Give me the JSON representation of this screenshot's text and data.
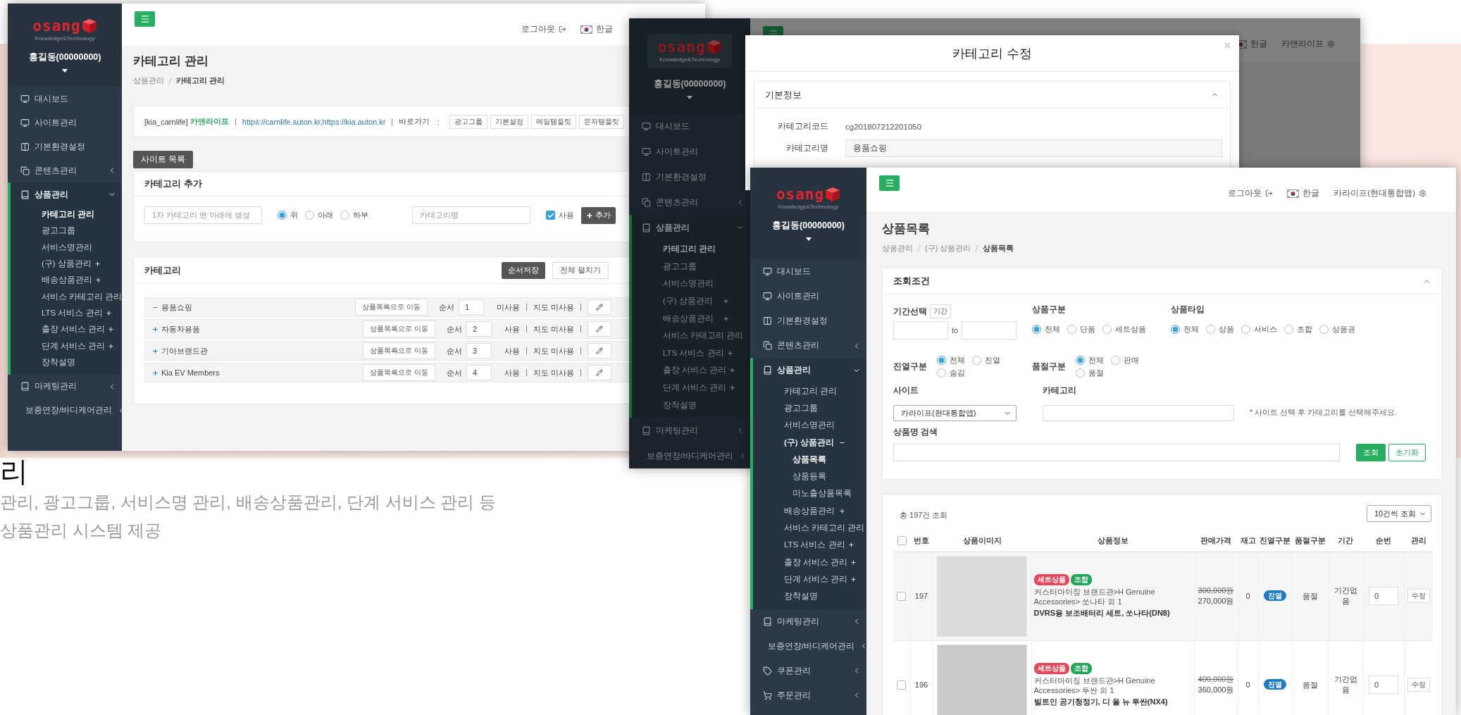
{
  "background": {
    "heading": "리",
    "description_lines": [
      "관리, 광고그룹, 서비스명 관리, 배송상품관리, 단계 서비스 관리 등",
      "상품관리 시스템 제공"
    ]
  },
  "category_window": {
    "sidebar": {
      "logo": {
        "wordmark": "osang",
        "tagline": "Knowledge&Technology"
      },
      "user": "홍길동(00000000)",
      "menu": [
        {
          "label": "대시보드",
          "kind": "monitor",
          "selected": false
        },
        {
          "label": "사이트관리",
          "kind": "monitor",
          "selected": false
        },
        {
          "label": "기본환경설정",
          "kind": "columns",
          "selected": false
        },
        {
          "label": "콘텐츠관리",
          "kind": "copy",
          "selected": false,
          "expanded": false
        },
        {
          "label": "상품관리",
          "kind": "book",
          "selected": false,
          "expanded": true,
          "children": [
            {
              "label": "카테고리 관리",
              "selected": true
            },
            {
              "label": "광고그룹",
              "selected": false
            },
            {
              "label": "서비스명관리",
              "selected": false
            },
            {
              "label": "(구) 상품관리",
              "selected": false,
              "expanded": false
            },
            {
              "label": "배송상품관리",
              "selected": false,
              "expanded": false
            },
            {
              "label": "서비스 카테고리 관리",
              "selected": false
            },
            {
              "label": "LTS 서비스 관리",
              "selected": false,
              "expanded": false
            },
            {
              "label": "출장 서비스 관리",
              "selected": false,
              "expanded": false
            },
            {
              "label": "단계 서비스 관리",
              "selected": false,
              "expanded": false
            },
            {
              "label": "장착설명",
              "selected": false
            }
          ]
        },
        {
          "label": "마케팅관리",
          "kind": "book",
          "selected": false,
          "expanded": false
        },
        {
          "label": "보증연장/바디케어관리",
          "kind": "book",
          "selected": false,
          "expanded": false
        }
      ]
    },
    "top_bar": {
      "logout": "로그아웃",
      "language": "한글"
    },
    "page_title": "카테고리 관리",
    "breadcrumb": [
      "상품관리",
      "카테고리 관리"
    ],
    "site_info": {
      "site_id": "[kia_carnlife]",
      "site_name": "카앤라이프",
      "url": "https://carnlife.auton.kr,https://kia.auton.kr",
      "shortcut_label": "바로가기",
      "shortcut_colon": ":",
      "shortcuts": [
        "광고그룹",
        "기본설정",
        "메일템플릿",
        "문자템플릿"
      ]
    },
    "site_list_button": "사이트 목록",
    "add_card": {
      "title": "카테고리 추가",
      "parent_placeholder": "1차 카테고리 맨 아래에 생성",
      "positions": [
        {
          "label": "위",
          "selected": true
        },
        {
          "label": "아래",
          "selected": false
        },
        {
          "label": "하부",
          "selected": false
        }
      ],
      "name_placeholder": "카테고리명",
      "use": {
        "label": "사용",
        "checked": true
      },
      "add_button": "추가"
    },
    "list_card": {
      "title": "카테고리",
      "save_order_button": "순서저장",
      "expand_all_button": "전체 펼치기",
      "rows": [
        {
          "name": "용품쇼핑",
          "expanded": true,
          "move_button": "상품목록으로 이동",
          "order_label": "순서",
          "order": "1",
          "status": "미사용",
          "map_status": "지도 미사용"
        },
        {
          "name": "자동차용품",
          "expanded": false,
          "move_button": "상품목록으로 이동",
          "order_label": "순서",
          "order": "2",
          "status": "사용",
          "map_status": "지도 미사용"
        },
        {
          "name": "기아브랜드관",
          "expanded": false,
          "move_button": "상품목록으로 이동",
          "order_label": "순서",
          "order": "3",
          "status": "사용",
          "map_status": "지도 미사용"
        },
        {
          "name": "Kia EV Members",
          "expanded": false,
          "move_button": "상품목록으로 이동",
          "order_label": "순서",
          "order": "4",
          "status": "사용",
          "map_status": "지도 미사용"
        }
      ]
    }
  },
  "edit_window": {
    "sidebar": {
      "logo": {
        "wordmark": "osang",
        "tagline": "Knowledge&Technology"
      },
      "user": "홍길동(00000000)",
      "menu": [
        {
          "label": "대시보드",
          "kind": "monitor",
          "selected": false
        },
        {
          "label": "사이트관리",
          "kind": "monitor",
          "selected": false
        },
        {
          "label": "기본환경설정",
          "kind": "columns",
          "selected": false
        },
        {
          "label": "콘텐츠관리",
          "kind": "copy",
          "selected": false,
          "expanded": false
        },
        {
          "label": "상품관리",
          "kind": "book",
          "selected": false,
          "expanded": true,
          "children": [
            {
              "label": "카테고리 관리",
              "selected": true
            },
            {
              "label": "광고그룹",
              "selected": false
            },
            {
              "label": "서비스명관리",
              "selected": false
            },
            {
              "label": "(구) 상품관리",
              "selected": false,
              "expanded": false
            },
            {
              "label": "배송상품관리",
              "selected": false,
              "expanded": false
            },
            {
              "label": "서비스 카테고리 관리",
              "selected": false
            },
            {
              "label": "LTS 서비스 관리",
              "selected": false,
              "expanded": false
            },
            {
              "label": "출장 서비스 관리",
              "selected": false,
              "expanded": false
            },
            {
              "label": "단계 서비스 관리",
              "selected": false,
              "expanded": false
            },
            {
              "label": "장착설명",
              "selected": false
            }
          ]
        },
        {
          "label": "마케팅관리",
          "kind": "book",
          "selected": false,
          "expanded": false
        },
        {
          "label": "보증연장/바디케어관리",
          "kind": "book",
          "selected": false,
          "expanded": false
        }
      ]
    },
    "top_bar": {
      "language": "한글",
      "site": "카앤라이프"
    },
    "modal": {
      "title": "카테고리 수정",
      "section": "기본정보",
      "fields": [
        {
          "label": "카테고리코드",
          "kind": "text",
          "value": "cg201807212201050"
        },
        {
          "label": "카테고리명",
          "kind": "input",
          "value": "용품쇼핑"
        }
      ]
    }
  },
  "product_window": {
    "sidebar": {
      "logo": {
        "wordmark": "osang",
        "tagline": "Knowledge&Technology"
      },
      "user": "홍길동(00000000)",
      "menu": [
        {
          "label": "대시보드",
          "kind": "monitor",
          "selected": false
        },
        {
          "label": "사이트관리",
          "kind": "monitor",
          "selected": false
        },
        {
          "label": "기본환경설정",
          "kind": "columns",
          "selected": false
        },
        {
          "label": "콘텐츠관리",
          "kind": "copy",
          "selected": false,
          "expanded": false
        },
        {
          "label": "상품관리",
          "kind": "book",
          "selected": false,
          "expanded": true,
          "children": [
            {
              "label": "카테고리 관리",
              "selected": false
            },
            {
              "label": "광고그룹",
              "selected": false
            },
            {
              "label": "서비스명관리",
              "selected": false
            },
            {
              "label": "(구) 상품관리",
              "selected": false,
              "expanded": true,
              "children": [
                {
                  "label": "상품목록",
                  "selected": true
                },
                {
                  "label": "상품등록",
                  "selected": false
                },
                {
                  "label": "미노출상품목록",
                  "selected": false
                }
              ]
            },
            {
              "label": "배송상품관리",
              "selected": false,
              "expanded": false
            },
            {
              "label": "서비스 카테고리 관리",
              "selected": false
            },
            {
              "label": "LTS 서비스 관리",
              "selected": false,
              "expanded": false
            },
            {
              "label": "출장 서비스 관리",
              "selected": false,
              "expanded": false
            },
            {
              "label": "단계 서비스 관리",
              "selected": false,
              "expanded": false
            },
            {
              "label": "장착설명",
              "selected": false
            }
          ]
        },
        {
          "label": "마케팅관리",
          "kind": "book",
          "selected": false,
          "expanded": false
        },
        {
          "label": "보증연장/바디케어관리",
          "kind": "book",
          "selected": false,
          "expanded": false
        },
        {
          "label": "쿠폰관리",
          "kind": "tag",
          "selected": false,
          "expanded": false
        },
        {
          "label": "주문관리",
          "kind": "cart",
          "selected": false,
          "expanded": false
        }
      ]
    },
    "top_bar": {
      "logout": "로그아웃",
      "language": "한글",
      "site": "카라이프(현대통합앱)"
    },
    "page_title": "상품목록",
    "breadcrumb": [
      "상품관리",
      "(구) 상품관리",
      "상품목록"
    ],
    "filters": {
      "title": "조회조건",
      "period": {
        "label": "기간선택",
        "tag": "기간",
        "to": "to"
      },
      "groups": [
        {
          "label": "상품구분",
          "kind": "stacked",
          "options": [
            {
              "label": "전체",
              "selected": true
            },
            {
              "label": "단품",
              "selected": false
            },
            {
              "label": "세트상품",
              "selected": false
            }
          ]
        },
        {
          "label": "상품타입",
          "kind": "stacked",
          "options": [
            {
              "label": "전체",
              "selected": true
            },
            {
              "label": "상품",
              "selected": false
            },
            {
              "label": "서비스",
              "selected": false
            },
            {
              "label": "조합",
              "selected": false
            },
            {
              "label": "상품권",
              "selected": false
            }
          ]
        },
        {
          "label": "진열구분",
          "kind": "inline",
          "options": [
            {
              "label": "전체",
              "selected": true
            },
            {
              "label": "진열",
              "selected": false
            },
            {
              "label": "숨김",
              "selected": false
            }
          ]
        },
        {
          "label": "품절구분",
          "kind": "inline",
          "options": [
            {
              "label": "전체",
              "selected": true
            },
            {
              "label": "판매",
              "selected": false
            },
            {
              "label": "품절",
              "selected": false
            }
          ]
        }
      ],
      "site": {
        "label": "사이트",
        "value": "카라이프(현대통합앱)"
      },
      "category": {
        "label": "카테고리",
        "note": "* 사이트 선택 후 카테고리를 선택해주세요."
      },
      "name_search": {
        "label": "상품명 검색"
      },
      "search_button": "조회",
      "reset_button": "초기화"
    },
    "results": {
      "total": "총 197건 조회",
      "page_size": "10건씩 조회",
      "all_checked": false,
      "columns": [
        "번호",
        "상품이미지",
        "상품정보",
        "판매가격",
        "재고",
        "진열구분",
        "품절구분",
        "기간",
        "순번",
        "관리"
      ],
      "rows": [
        {
          "checked": false,
          "no": "197",
          "tags": [
            {
              "label": "세트상품",
              "color": "#e6485b"
            },
            {
              "label": "조합",
              "color": "#23a55a"
            }
          ],
          "path": "커스터마이징 브랜드관>H Genuine Accessories> 쏘나타 외 1",
          "name": "DVRS용 보조배터리 세트, 쏘나타(DN8)",
          "list_price": "300,000원",
          "price": "270,000원",
          "stock": "0",
          "display": "진열",
          "soldout": "품절",
          "period": "기간없음",
          "order": "0",
          "edit_button": "수정"
        },
        {
          "checked": false,
          "no": "196",
          "tags": [
            {
              "label": "세트상품",
              "color": "#e6485b"
            },
            {
              "label": "조합",
              "color": "#23a55a"
            }
          ],
          "path": "커스터마이징 브랜드관>H Genuine Accessories> 투싼 외 1",
          "name": "빌트인 공기청정기, 디 올 뉴 투싼(NX4)",
          "list_price": "400,000원",
          "price": "360,000원",
          "stock": "0",
          "display": "진열",
          "soldout": "품절",
          "period": "기간없음",
          "order": "0",
          "edit_button": "수정"
        }
      ]
    }
  }
}
